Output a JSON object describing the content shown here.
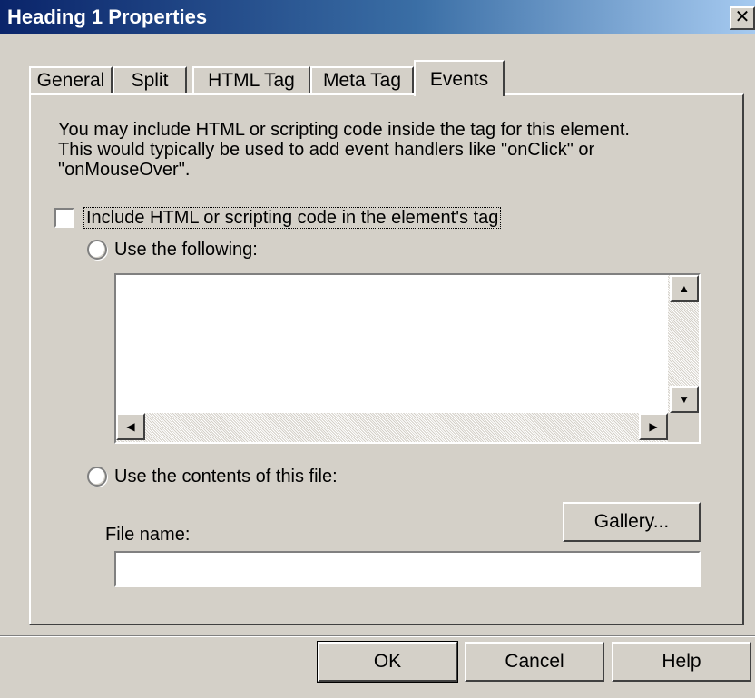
{
  "dialog": {
    "title": "Heading 1 Properties",
    "close_glyph": "✕"
  },
  "tabs": [
    {
      "label": "General"
    },
    {
      "label": "Split"
    },
    {
      "label": "HTML Tag"
    },
    {
      "label": "Meta Tag"
    },
    {
      "label": "Events",
      "active": true
    }
  ],
  "events": {
    "description_lines": [
      "You may include HTML or scripting code inside the tag for this element.",
      "This would typically be used to add event handlers like \"onClick\" or",
      "\"onMouseOver\"."
    ],
    "include_checkbox": {
      "label": "Include HTML or scripting code in the element's tag",
      "checked": false
    },
    "use_following": {
      "label": "Use the following:",
      "selected": false,
      "value": ""
    },
    "use_file": {
      "label": "Use the contents of this file:",
      "selected": false
    },
    "gallery_button": "Gallery...",
    "file_name_label": "File name:",
    "file_name_value": ""
  },
  "buttons": {
    "ok": "OK",
    "cancel": "Cancel",
    "help": "Help"
  }
}
